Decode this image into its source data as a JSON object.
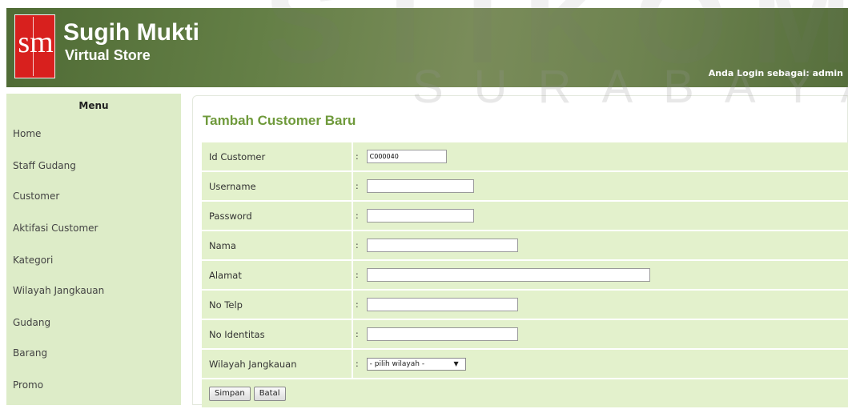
{
  "header": {
    "logo_text": "sm",
    "brand_title": "Sugih Mukti",
    "brand_subtitle": "Virtual Store",
    "login_info": "Anda Login sebagai: admin",
    "colors": {
      "bg": "#647f46",
      "logo_red": "#d8201e"
    }
  },
  "watermark": {
    "top": "STIKOM",
    "middle": "SURABAYA"
  },
  "sidebar": {
    "title": "Menu",
    "items": [
      {
        "label": "Home"
      },
      {
        "label": "Staff Gudang"
      },
      {
        "label": "Customer"
      },
      {
        "label": "Aktifasi Customer"
      },
      {
        "label": "Kategori"
      },
      {
        "label": "Wilayah Jangkauan"
      },
      {
        "label": "Gudang"
      },
      {
        "label": "Barang"
      },
      {
        "label": "Promo"
      }
    ]
  },
  "main": {
    "title": "Tambah Customer Baru",
    "colon": ":",
    "fields": [
      {
        "label": "Id Customer",
        "value": "C000040",
        "placeholder": ""
      },
      {
        "label": "Username",
        "value": "",
        "placeholder": ""
      },
      {
        "label": "Password",
        "value": "",
        "placeholder": ""
      },
      {
        "label": "Nama",
        "value": "",
        "placeholder": ""
      },
      {
        "label": "Alamat",
        "value": "",
        "placeholder": ""
      },
      {
        "label": "No Telp",
        "value": "",
        "placeholder": ""
      },
      {
        "label": "No Identitas",
        "value": "",
        "placeholder": ""
      }
    ],
    "wilayah": {
      "label": "Wilayah Jangkauan",
      "selected": "- pilih wilayah -"
    },
    "buttons": {
      "save": "Simpan",
      "cancel": "Batal"
    },
    "colors": {
      "title": "#6f9a3b",
      "row_bg": "#e3f1cc",
      "sidebar_bg": "#ddecc8"
    }
  }
}
